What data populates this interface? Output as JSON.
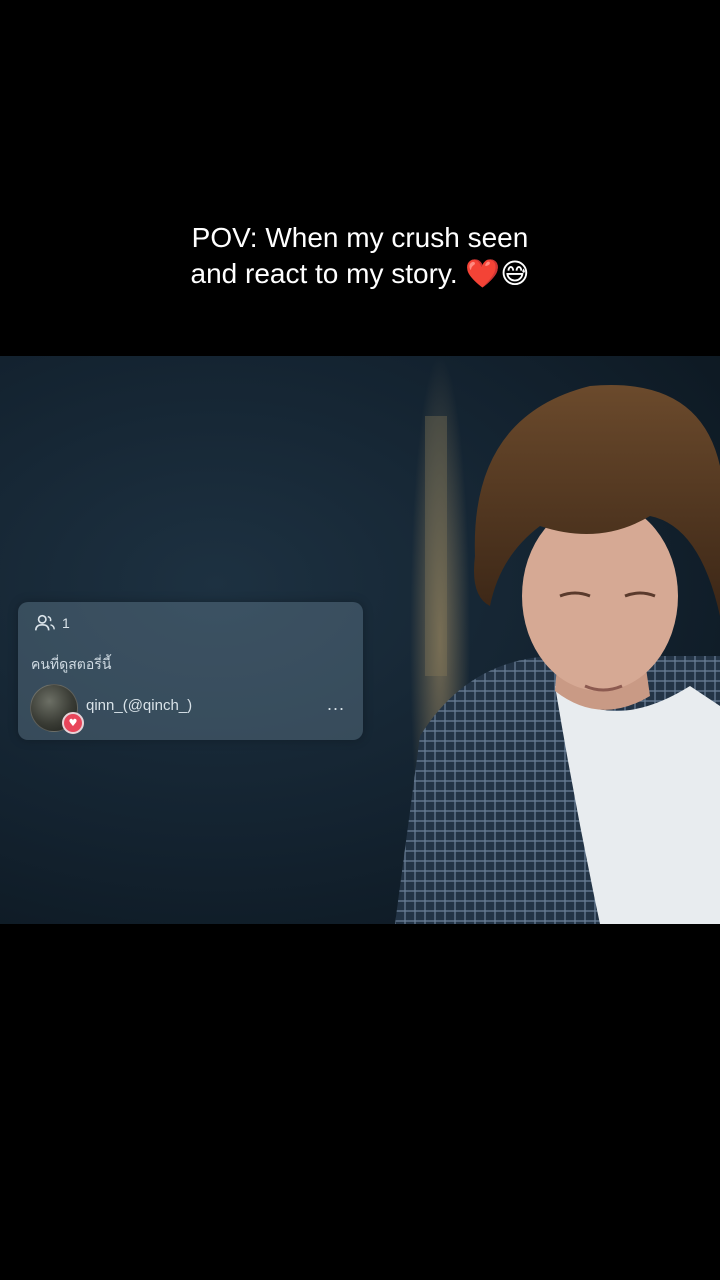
{
  "caption": {
    "line1": "POV: When my crush seen",
    "line2_text": "and react to my story.",
    "emoji_heart": "❤️",
    "emoji_face": "😅"
  },
  "story_viewers": {
    "count": "1",
    "title": "คนที่ดูสตอรี่นี้",
    "viewers": [
      {
        "name": "qinn_(@qinch_)",
        "reaction": "heart",
        "more_label": "..."
      }
    ]
  },
  "colors": {
    "background": "#000000",
    "caption_text": "#ffffff",
    "reaction_badge": "#e8455a",
    "card_overlay": "#6e8a9c"
  },
  "icons": {
    "viewers_icon": "people-icon",
    "reaction_icon": "heart-icon",
    "more_icon": "more-dots-icon"
  }
}
